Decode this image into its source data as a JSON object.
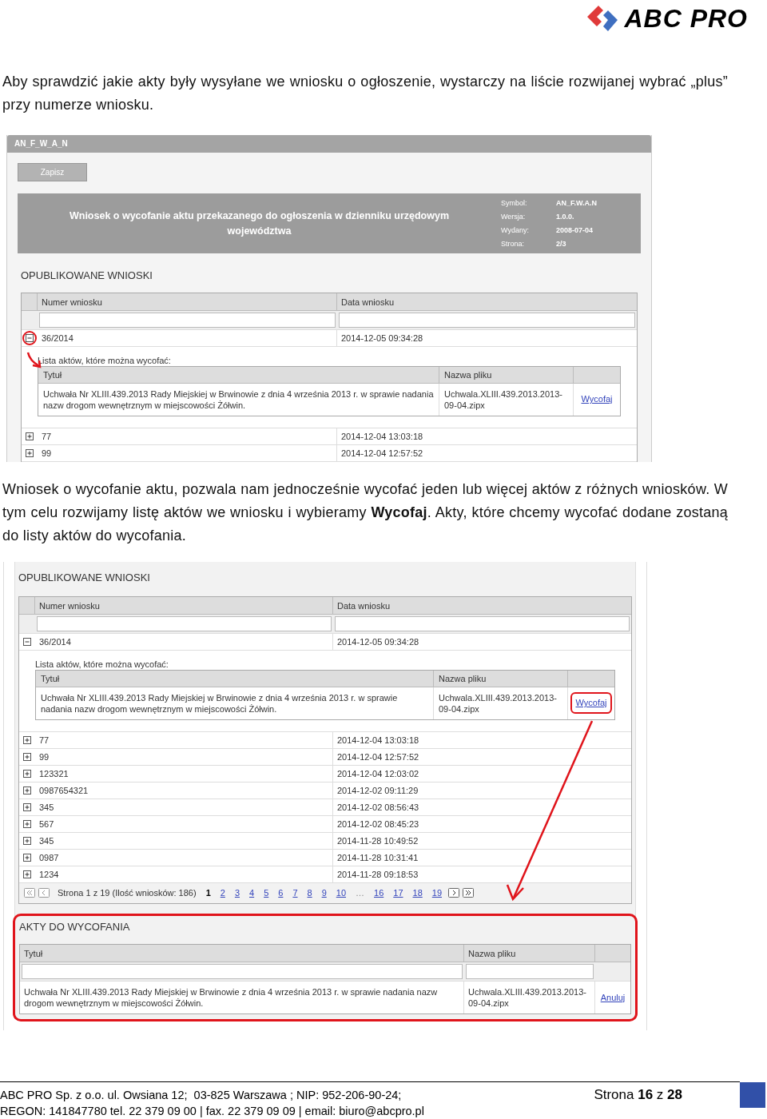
{
  "logo": {
    "text": "ABC PRO"
  },
  "intro": "Aby sprawdzić jakie akty były wysyłane we wniosku o ogłoszenie, wystarczy na liście rozwijanej wybrać „plus” przy numerze wniosku.",
  "screenshot_1": {
    "window_title": "AN_F_W_A_N",
    "save_button": "Zapisz",
    "form_title": "Wniosek o wycofanie aktu przekazanego do ogłoszenia w dzienniku urzędowym województwa",
    "meta": [
      {
        "label": "Symbol:",
        "value": "AN_F.W.A.N"
      },
      {
        "label": "Wersja:",
        "value": "1.0.0."
      },
      {
        "label": "Wydany:",
        "value": "2008-07-04"
      },
      {
        "label": "Strona:",
        "value": "2/3"
      }
    ],
    "section_title": "OPUBLIKOWANE WNIOSKI",
    "columns": [
      "Numer wniosku",
      "Data wniosku"
    ],
    "rows": [
      {
        "number": "36/2014",
        "date": "2014-12-05 09:34:28",
        "expanded": true,
        "highlighted": true,
        "caption": "Lista aktów, które można wycofać:",
        "sub_columns": [
          "Tytuł",
          "Nazwa pliku"
        ],
        "acts": [
          {
            "title": "Uchwała Nr XLIII.439.2013 Rady Miejskiej w Brwinowie z dnia 4 września 2013 r. w sprawie nadania nazw drogom wewnętrznym w miejscowości Żółwin.",
            "file": "Uchwala.XLIII.439.2013.2013-09-04.zipx",
            "action": "Wycofaj"
          }
        ]
      },
      {
        "number": "77",
        "date": "2014-12-04 13:03:18",
        "expanded": false
      },
      {
        "number": "99",
        "date": "2014-12-04 12:57:52",
        "expanded": false
      }
    ]
  },
  "paragraph": "Wniosek o wycofanie aktu, pozwala nam jednocześnie wycofać jeden lub więcej aktów z różnych wniosków. W tym celu rozwijamy listę aktów we wniosku i wybieramy **Wycofaj**. Akty, które chcemy wycofać dodane zostaną do listy aktów do wycofania.",
  "screenshot_2": {
    "section_title": "OPUBLIKOWANE WNIOSKI",
    "columns": [
      "Numer wniosku",
      "Data wniosku"
    ],
    "rows": [
      {
        "number": "36/2014",
        "date": "2014-12-05 09:34:28",
        "expanded": true,
        "caption": "Lista aktów, które można wycofać:",
        "sub_columns": [
          "Tytuł",
          "Nazwa pliku"
        ],
        "acts": [
          {
            "title": "Uchwała Nr XLIII.439.2013 Rady Miejskiej w Brwinowie z dnia 4 września 2013 r. w sprawie nadania nazw drogom wewnętrznym w miejscowości Żółwin.",
            "file": "Uchwala.XLIII.439.2013.2013-09-04.zipx",
            "action": "Wycofaj",
            "highlighted": true
          }
        ]
      },
      {
        "number": "77",
        "date": "2014-12-04 13:03:18",
        "expanded": false
      },
      {
        "number": "99",
        "date": "2014-12-04 12:57:52",
        "expanded": false
      },
      {
        "number": "123321",
        "date": "2014-12-04 12:03:02",
        "expanded": false
      },
      {
        "number": "0987654321",
        "date": "2014-12-02 09:11:29",
        "expanded": false
      },
      {
        "number": "345",
        "date": "2014-12-02 08:56:43",
        "expanded": false
      },
      {
        "number": "567",
        "date": "2014-12-02 08:45:23",
        "expanded": false
      },
      {
        "number": "345",
        "date": "2014-11-28 10:49:52",
        "expanded": false
      },
      {
        "number": "0987",
        "date": "2014-11-28 10:31:41",
        "expanded": false
      },
      {
        "number": "1234",
        "date": "2014-11-28 09:18:53",
        "expanded": false
      }
    ],
    "pager": {
      "info": "Strona 1 z 19 (Ilość wniosków: 186)",
      "pages": [
        {
          "label": "1",
          "selected": true
        },
        {
          "label": "2",
          "selected": false
        },
        {
          "label": "3",
          "selected": false
        },
        {
          "label": "4",
          "selected": false
        },
        {
          "label": "5",
          "selected": false
        },
        {
          "label": "6",
          "selected": false
        },
        {
          "label": "7",
          "selected": false
        },
        {
          "label": "8",
          "selected": false
        },
        {
          "label": "9",
          "selected": false
        },
        {
          "label": "10",
          "selected": false
        },
        {
          "label": "…",
          "kind": "ellipsis"
        },
        {
          "label": "16",
          "selected": false
        },
        {
          "label": "17",
          "selected": false
        },
        {
          "label": "18",
          "selected": false
        },
        {
          "label": "19",
          "selected": false
        }
      ]
    },
    "withdraw": {
      "title": "AKTY DO WYCOFANIA",
      "highlighted": true,
      "columns": [
        "Tytuł",
        "Nazwa pliku"
      ],
      "acts": [
        {
          "title": "Uchwała Nr XLIII.439.2013 Rady Miejskiej w Brwinowie z dnia 4 września 2013 r. w sprawie nadania nazw drogom wewnętrznym w miejscowości Żółwin.",
          "file": "Uchwala.XLIII.439.2013.2013-09-04.zipx",
          "action": "Anuluj"
        }
      ]
    }
  },
  "footer": {
    "lines": [
      "ABC PRO Sp. z o.o. ul. Owsiana 12;  03-825 Warszawa ; NIP: 952-206-90-24;",
      "REGON: 141847780 tel. 22 379 09 00 | fax. 22 379 09 09 | email: biuro@abcpro.pl"
    ],
    "page": "Strona **16** z **28**"
  }
}
